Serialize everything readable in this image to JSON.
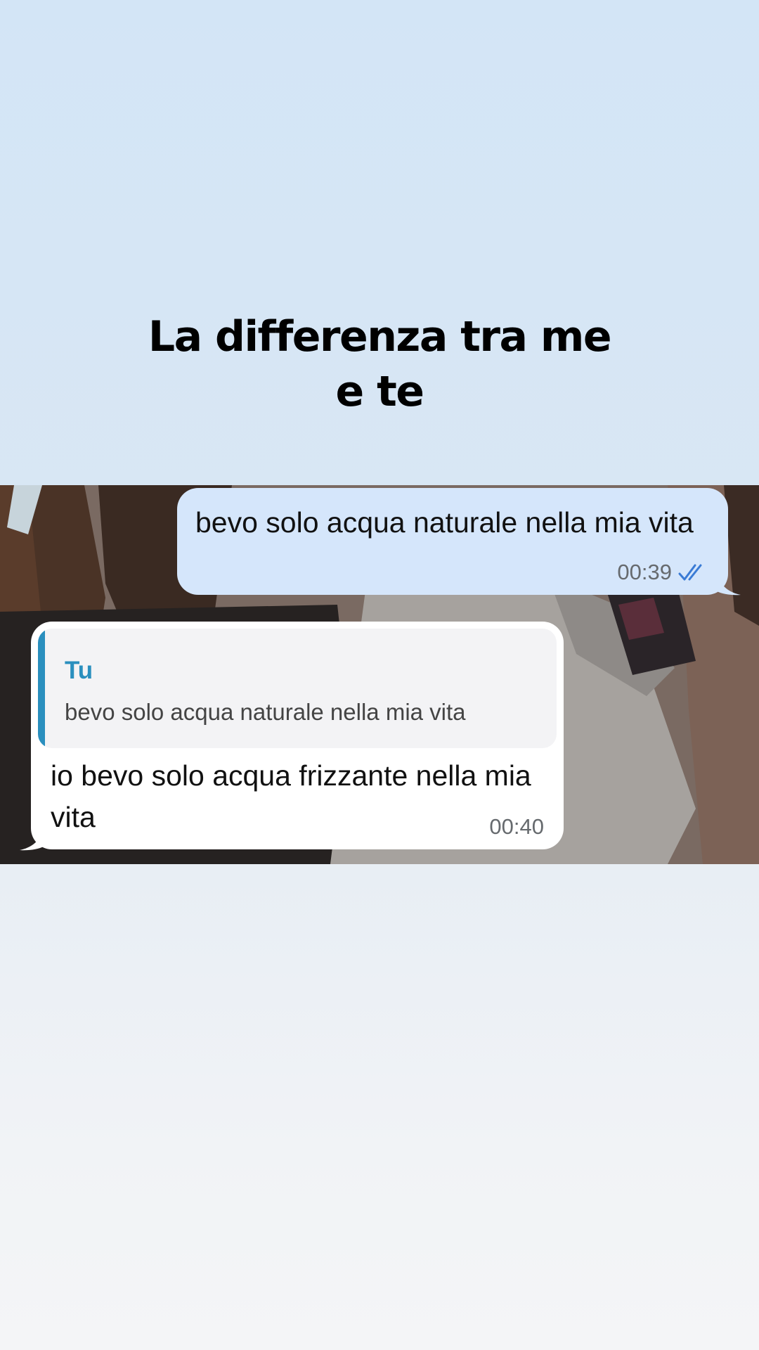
{
  "caption": {
    "line1": "La differenza tra me",
    "line2": "e te"
  },
  "chat": {
    "outgoing": {
      "text": "bevo solo acqua naturale nella mia vita",
      "time": "00:39",
      "status_icon": "double-check-read-icon",
      "bubble_color": "#d5e6fb",
      "tick_color": "#3a7bd5"
    },
    "incoming": {
      "reply": {
        "author": "Tu",
        "text": "bevo solo acqua naturale nella mia vita",
        "accent_color": "#2a8fbe"
      },
      "text": "io bevo solo acqua frizzante nella mia vita",
      "time": "00:40",
      "bubble_color": "#ffffff"
    }
  }
}
